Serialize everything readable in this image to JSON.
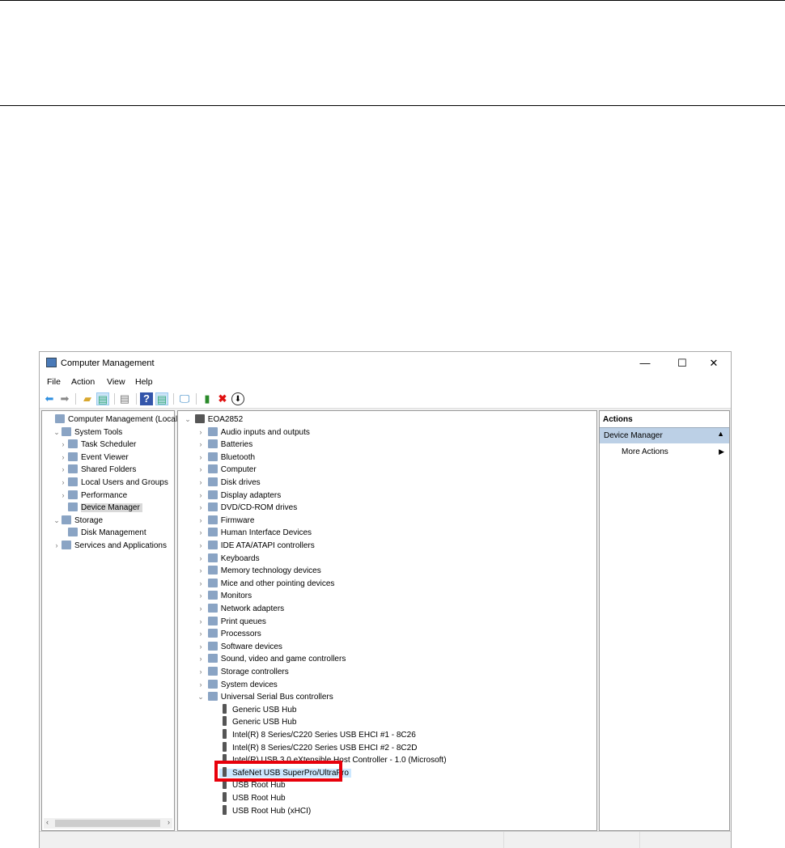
{
  "window": {
    "title": "Computer Management",
    "minimize": "—",
    "maximize": "☐",
    "close": "✕"
  },
  "menu": [
    "File",
    "Action",
    "View",
    "Help"
  ],
  "left_tree": [
    {
      "label": "Computer Management (Local",
      "level": 0,
      "chev": ""
    },
    {
      "label": "System Tools",
      "level": 1,
      "chev": "⌄"
    },
    {
      "label": "Task Scheduler",
      "level": 2,
      "chev": "›"
    },
    {
      "label": "Event Viewer",
      "level": 2,
      "chev": "›"
    },
    {
      "label": "Shared Folders",
      "level": 2,
      "chev": "›"
    },
    {
      "label": "Local Users and Groups",
      "level": 2,
      "chev": "›"
    },
    {
      "label": "Performance",
      "level": 2,
      "chev": "›"
    },
    {
      "label": "Device Manager",
      "level": 2,
      "chev": "",
      "selected": true
    },
    {
      "label": "Storage",
      "level": 1,
      "chev": "⌄"
    },
    {
      "label": "Disk Management",
      "level": 2,
      "chev": ""
    },
    {
      "label": "Services and Applications",
      "level": 1,
      "chev": "›"
    }
  ],
  "device_root": "EOA2852",
  "devices": [
    "Audio inputs and outputs",
    "Batteries",
    "Bluetooth",
    "Computer",
    "Disk drives",
    "Display adapters",
    "DVD/CD-ROM drives",
    "Firmware",
    "Human Interface Devices",
    "IDE ATA/ATAPI controllers",
    "Keyboards",
    "Memory technology devices",
    "Mice and other pointing devices",
    "Monitors",
    "Network adapters",
    "Print queues",
    "Processors",
    "Software devices",
    "Sound, video and game controllers",
    "Storage controllers",
    "System devices",
    "Universal Serial Bus controllers"
  ],
  "usb_devices": [
    "Generic USB Hub",
    "Generic USB Hub",
    "Intel(R) 8 Series/C220 Series USB EHCI #1 - 8C26",
    "Intel(R) 8 Series/C220 Series USB EHCI #2 - 8C2D",
    "Intel(R) USB 3.0 eXtensible Host Controller - 1.0 (Microsoft)",
    "SafeNet USB SuperPro/UltraPro",
    "USB Root Hub",
    "USB Root Hub",
    "USB Root Hub (xHCI)"
  ],
  "highlighted_usb_index": 5,
  "actions": {
    "header": "Actions",
    "section": "Device Manager",
    "item": "More Actions"
  },
  "colors": {
    "highlight_box": "#e8000b",
    "selection": "#cce8ff"
  }
}
